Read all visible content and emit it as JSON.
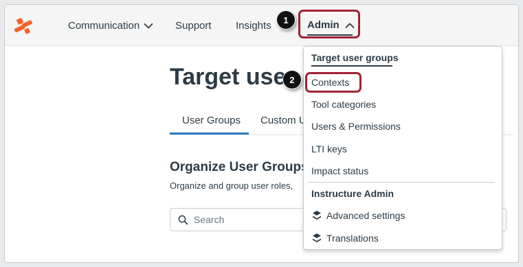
{
  "header": {
    "logo_icon": "instructure-logo-icon",
    "nav": [
      {
        "label": "Communication",
        "icon": "chevron-down-icon"
      },
      {
        "label": "Support"
      },
      {
        "label": "Insights"
      }
    ],
    "admin": {
      "label": "Admin",
      "icon": "chevron-up-icon"
    }
  },
  "callouts": [
    "1",
    "2"
  ],
  "page": {
    "title": "Target user",
    "tabs": [
      "User Groups",
      "Custom U"
    ],
    "section_title": "Organize User Groups",
    "section_desc": "Organize and group user roles,",
    "search": {
      "placeholder": "Search",
      "value": ""
    }
  },
  "admin_menu": {
    "items": [
      {
        "label": "Target user groups",
        "active": true
      },
      {
        "label": "Contexts"
      },
      {
        "label": "Tool categories"
      },
      {
        "label": "Users & Permissions"
      },
      {
        "label": "LTI keys"
      },
      {
        "label": "Impact status"
      }
    ],
    "heading": "Instructure Admin",
    "sub_items": [
      {
        "label": "Advanced settings",
        "icon": "layers-icon"
      },
      {
        "label": "Translations",
        "icon": "layers-icon"
      }
    ]
  },
  "colors": {
    "brand": "#f7602b",
    "highlight": "#a32135",
    "text": "#2d3b45",
    "tab_accent": "#2b7abc"
  }
}
